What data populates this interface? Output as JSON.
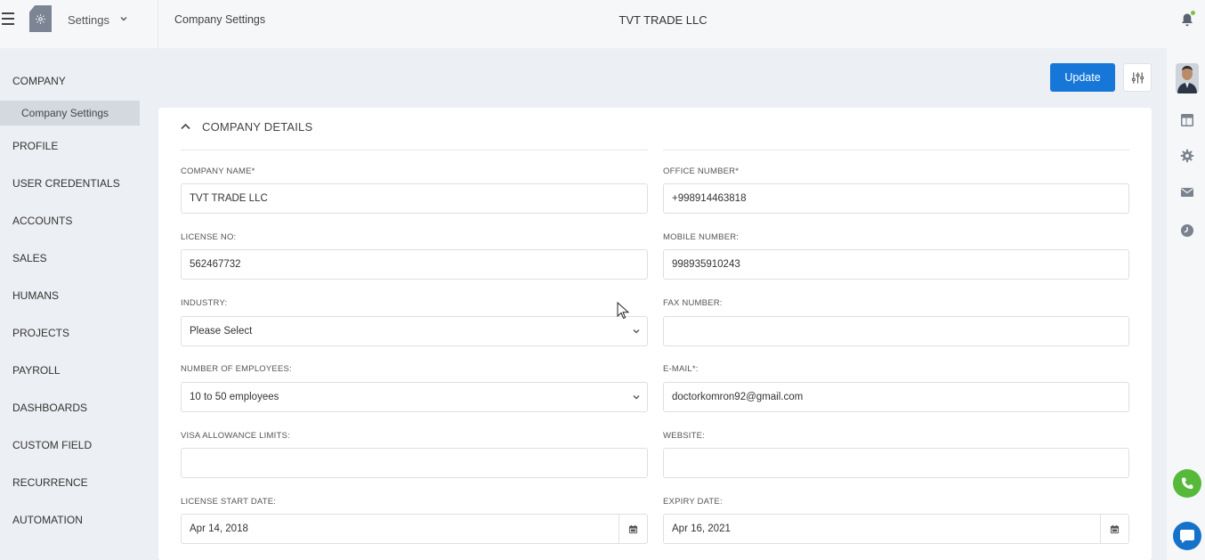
{
  "topbar": {
    "app_name": "Settings",
    "breadcrumb": "Company Settings",
    "company_title": "TVT TRADE LLC"
  },
  "leftnav": {
    "section": "COMPANY",
    "active_sub": "Company Settings",
    "items": [
      "PROFILE",
      "USER CREDENTIALS",
      "ACCOUNTS",
      "SALES",
      "HUMANS",
      "PROJECTS",
      "PAYROLL",
      "DASHBOARDS",
      "CUSTOM FIELD",
      "RECURRENCE",
      "AUTOMATION"
    ]
  },
  "actions": {
    "update_label": "Update"
  },
  "section": {
    "title": "COMPANY DETAILS"
  },
  "form": {
    "company_name_label": "COMPANY NAME*",
    "company_name_value": "TVT TRADE LLC",
    "office_number_label": "OFFICE NUMBER*",
    "office_number_value": "+998914463818",
    "license_no_label": "LICENSE NO:",
    "license_no_value": "562467732",
    "mobile_number_label": "MOBILE NUMBER:",
    "mobile_number_value": "998935910243",
    "industry_label": "INDUSTRY:",
    "industry_value": "Please Select",
    "fax_number_label": "FAX NUMBER:",
    "fax_number_value": "",
    "employees_label": "NUMBER OF EMPLOYEES:",
    "employees_value": "10 to 50 employees",
    "email_label": "E-MAIL*:",
    "email_value": "doctorkomron92@gmail.com",
    "visa_label": "VISA ALLOWANCE LIMITS:",
    "visa_value": "",
    "website_label": "WEBSITE:",
    "website_value": "",
    "license_start_label": "LICENSE START DATE:",
    "license_start_value": "Apr 14, 2018",
    "expiry_label": "EXPIRY DATE:",
    "expiry_value": "Apr 16, 2021"
  },
  "icons": {
    "menu": "hamburger-icon",
    "logo": "gear-icon",
    "notifications": "bell-icon",
    "filter": "sliders-icon",
    "rail": [
      "layout-icon",
      "gear-icon",
      "mail-icon",
      "clock-icon"
    ],
    "call": "phone-icon",
    "chat": "chat-icon",
    "calendar": "calendar-icon"
  },
  "colors": {
    "primary": "#1677d9",
    "call": "#57b93a",
    "chat": "#1672c9",
    "notification_dot": "#7dc243"
  }
}
